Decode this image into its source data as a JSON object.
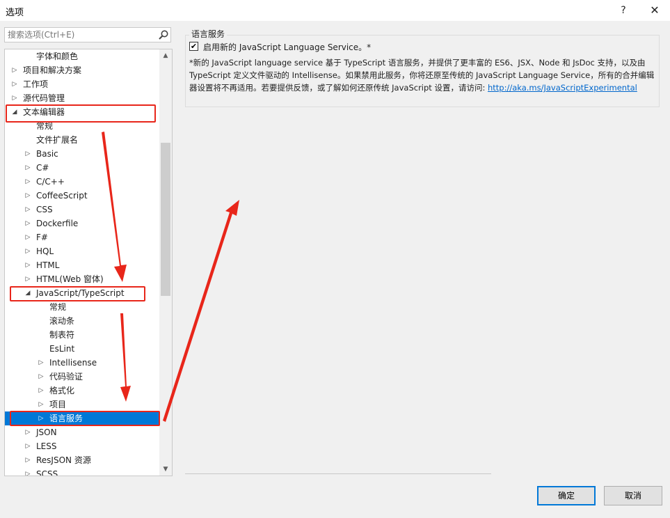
{
  "window": {
    "title": "选项",
    "help_glyph": "?",
    "close_glyph": "✕"
  },
  "search": {
    "placeholder": "搜索选项(Ctrl+E)",
    "value": ""
  },
  "tree": {
    "items": [
      {
        "label": "字体和颜色",
        "expander": ""
      },
      {
        "label": "项目和解决方案",
        "expander": "▷"
      },
      {
        "label": "工作项",
        "expander": "▷"
      },
      {
        "label": "源代码管理",
        "expander": "▷"
      },
      {
        "label": "文本编辑器",
        "expander": "◢"
      },
      {
        "label": "常规",
        "expander": ""
      },
      {
        "label": "文件扩展名",
        "expander": ""
      },
      {
        "label": "Basic",
        "expander": "▷"
      },
      {
        "label": "C#",
        "expander": "▷"
      },
      {
        "label": "C/C++",
        "expander": "▷"
      },
      {
        "label": "CoffeeScript",
        "expander": "▷"
      },
      {
        "label": "CSS",
        "expander": "▷"
      },
      {
        "label": "Dockerfile",
        "expander": "▷"
      },
      {
        "label": "F#",
        "expander": "▷"
      },
      {
        "label": "HQL",
        "expander": "▷"
      },
      {
        "label": "HTML",
        "expander": "▷"
      },
      {
        "label": "HTML(Web 窗体)",
        "expander": "▷"
      },
      {
        "label": "JavaScript/TypeScript",
        "expander": "◢"
      },
      {
        "label": "常规",
        "expander": ""
      },
      {
        "label": "滚动条",
        "expander": ""
      },
      {
        "label": "制表符",
        "expander": ""
      },
      {
        "label": "EsLint",
        "expander": ""
      },
      {
        "label": "Intellisense",
        "expander": "▷"
      },
      {
        "label": "代码验证",
        "expander": "▷"
      },
      {
        "label": "格式化",
        "expander": "▷"
      },
      {
        "label": "项目",
        "expander": "▷"
      },
      {
        "label": "语言服务",
        "expander": "▷"
      },
      {
        "label": "JSON",
        "expander": "▷"
      },
      {
        "label": "LESS",
        "expander": "▷"
      },
      {
        "label": "ResJSON 资源",
        "expander": "▷"
      },
      {
        "label": "SCSS",
        "expander": "▷"
      }
    ],
    "selected_label": "语言服务",
    "scroll_up_glyph": "▲",
    "scroll_down_glyph": "▼"
  },
  "panel": {
    "group_title": "语言服务",
    "checkbox_label": "启用新的 JavaScript Language Service。*",
    "checkbox_checked": true,
    "checkbox_glyph": "✔",
    "description": "*新的 JavaScript language service 基于 TypeScript 语言服务，并提供了更丰富的 ES6、JSX、Node 和 JsDoc 支持，以及由 TypeScript 定义文件驱动的 Intellisense。如果禁用此服务，你将还原至传统的 JavaScript Language Service，所有的合并编辑器设置将不再适用。若要提供反馈，或了解如何还原传统 JavaScript 设置，请访问: ",
    "link_text": "http://aka.ms/JavaScriptExperimental"
  },
  "buttons": {
    "ok": "确定",
    "cancel": "取消"
  },
  "colors": {
    "accent": "#0078d7",
    "annotation_red": "#e8261a",
    "link": "#0066cc"
  }
}
